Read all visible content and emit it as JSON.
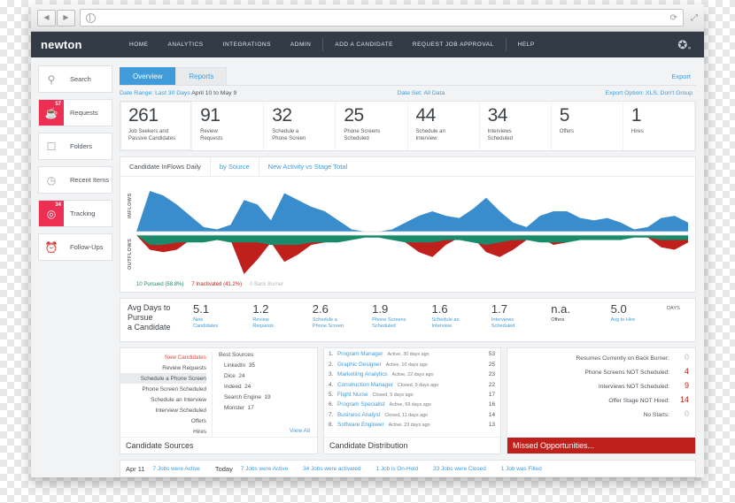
{
  "browser": {
    "url_value": "",
    "url_placeholder": "",
    "back_icon": "◀",
    "forward_icon": "▶",
    "reload_icon": "⟳",
    "expand_icon": "⤢"
  },
  "topnav": {
    "brand": "newton",
    "links": [
      "HOME",
      "ANALYTICS",
      "INTEGRATIONS",
      "ADMIN",
      "ADD A CANDIDATE",
      "REQUEST JOB APPROVAL",
      "HELP"
    ],
    "gear_icon": "✿"
  },
  "sidebar": {
    "items": [
      {
        "label": "Search",
        "icon": "search-icon",
        "glyph": "⌕",
        "badge": "",
        "active": false
      },
      {
        "label": "Requests",
        "icon": "bell-icon",
        "glyph": "🔔",
        "badge": "57",
        "active": true
      },
      {
        "label": "Folders",
        "icon": "folder-icon",
        "glyph": "🗀",
        "badge": "",
        "active": false
      },
      {
        "label": "Recent Items",
        "icon": "clock-icon",
        "glyph": "🕐",
        "badge": "",
        "active": false
      },
      {
        "label": "Tracking",
        "icon": "target-icon",
        "glyph": "◎",
        "badge": "34",
        "active": true
      },
      {
        "label": "Follow-Ups",
        "icon": "alarm-clock-icon",
        "glyph": "⏰",
        "badge": "",
        "active": false
      }
    ]
  },
  "tabs": {
    "items": [
      "Overview",
      "Reports"
    ],
    "active": "Overview",
    "export_label": "Export"
  },
  "meta": {
    "date_range_label": "Date Range:",
    "date_range_value": "Last 30 Days",
    "date_range_detail": "April 10 to May 9",
    "date_set": "Date Set: All Data",
    "export_option": "Export Option: XLS, Don't Group"
  },
  "stats": [
    {
      "num": "261",
      "label": "Job Seekers and\nPassive Candidates"
    },
    {
      "num": "91",
      "label": "Review\nRequests"
    },
    {
      "num": "32",
      "label": "Schedule a\nPhone Screen"
    },
    {
      "num": "25",
      "label": "Phone Screens\nScheduled"
    },
    {
      "num": "44",
      "label": "Schedule an\nInterview"
    },
    {
      "num": "34",
      "label": "Interviews\nScheduled"
    },
    {
      "num": "5",
      "label": "Offers"
    },
    {
      "num": "1",
      "label": "Hires"
    }
  ],
  "chart_tabs": {
    "items": [
      "Candidate InFlows Daily",
      "by Source",
      "New Activity vs Stage Total"
    ],
    "active": "by Source"
  },
  "chart_data": {
    "type": "area",
    "title": "Candidate InFlows Daily",
    "axis_labels": [
      "INFLOWS",
      "OUTFLOWS"
    ],
    "legend": [
      {
        "text": "10 Pursued (58.8%)",
        "color": "#1a8a6a"
      },
      {
        "text": "7 Inactivated (41.2%)",
        "color": "#c0201c"
      },
      {
        "text": "0 Back Burner",
        "color": "#b4b8bc"
      }
    ],
    "colors": {
      "inflows": "#3a8dcc",
      "pursued": "#1a8a6a",
      "inactivated": "#c0201c"
    },
    "x": [
      0,
      1,
      2,
      3,
      4,
      5,
      6,
      7,
      8,
      9,
      10,
      11,
      12,
      13,
      14,
      15,
      16,
      17,
      18,
      19,
      20,
      21,
      22,
      23,
      24,
      25,
      26,
      27,
      28,
      29,
      30,
      31,
      32,
      33,
      34,
      35,
      36,
      37,
      38,
      39
    ],
    "series": [
      {
        "name": "INFLOWS",
        "values": [
          0,
          18,
          16,
          12,
          7,
          2,
          1,
          3,
          14,
          12,
          5,
          17,
          14,
          11,
          9,
          5,
          1,
          0,
          0,
          1,
          4,
          7,
          9,
          7,
          6,
          10,
          15,
          9,
          4,
          2,
          7,
          9,
          9,
          6,
          5,
          6,
          4,
          1,
          2,
          6,
          7,
          4
        ]
      },
      {
        "name": "Pursued",
        "values": [
          0,
          4,
          4,
          3,
          3,
          3,
          2,
          3,
          3,
          3,
          4,
          4,
          4,
          3,
          3,
          3,
          2,
          1,
          1,
          2,
          3,
          3,
          3,
          2,
          2,
          3,
          4,
          3,
          2,
          2,
          3,
          3,
          3,
          2,
          2,
          2,
          2,
          1,
          1,
          2,
          2,
          2
        ]
      },
      {
        "name": "Inactivated",
        "values": [
          0,
          6,
          7,
          6,
          2,
          1,
          1,
          2,
          16,
          10,
          3,
          11,
          8,
          4,
          3,
          2,
          1,
          0,
          0,
          1,
          3,
          7,
          9,
          4,
          1,
          1,
          7,
          9,
          6,
          2,
          1,
          4,
          3,
          1,
          1,
          1,
          1,
          0,
          1,
          5,
          6,
          3
        ]
      }
    ],
    "grid": false,
    "legend_position": "bottom-left"
  },
  "avg_days": {
    "title": "Avg Days to Pursue\na Candidate",
    "unit": "DAYS",
    "cells": [
      {
        "value": "5.1",
        "label": "New\nCandidates",
        "muted": false
      },
      {
        "value": "1.2",
        "label": "Review\nRequests",
        "muted": false
      },
      {
        "value": "2.6",
        "label": "Schedule a\nPhone Screen",
        "muted": false
      },
      {
        "value": "1.9",
        "label": "Phone Screens\nScheduled",
        "muted": false
      },
      {
        "value": "1.6",
        "label": "Schedule an\nInterview",
        "muted": false
      },
      {
        "value": "1.7",
        "label": "Interviews\nScheduled",
        "muted": false
      },
      {
        "value": "n.a.",
        "label": "Offers",
        "muted": true
      },
      {
        "value": "5.0",
        "label": "Avg to Hire",
        "muted": false
      }
    ]
  },
  "candidate_sources": {
    "title": "Candidate Sources",
    "stages": [
      {
        "label": "New Candidates",
        "style": "red"
      },
      {
        "label": "Review Requests",
        "style": ""
      },
      {
        "label": "Schedule a Phone Screen",
        "style": "hl"
      },
      {
        "label": "Phone Screen Scheduled",
        "style": ""
      },
      {
        "label": "Schedule an Interview",
        "style": ""
      },
      {
        "label": "Interview Scheduled",
        "style": ""
      },
      {
        "label": "Offers",
        "style": ""
      },
      {
        "label": "Hires",
        "style": ""
      }
    ],
    "best_sources_header": "Best Sources",
    "best_sources": [
      {
        "name": "LinkedIn",
        "count": "35"
      },
      {
        "name": "Dice",
        "count": "24"
      },
      {
        "name": "Indeed",
        "count": "24"
      },
      {
        "name": "Search Engine",
        "count": "19"
      },
      {
        "name": "Monster",
        "count": "17"
      }
    ],
    "view_all": "View All"
  },
  "candidate_distribution": {
    "title": "Candidate Distribution",
    "jobs": [
      {
        "idx": "1.",
        "name": "Program Manager",
        "status": "Active, 30 days ago",
        "count": "53"
      },
      {
        "idx": "2.",
        "name": "Graphic Designer",
        "status": "Active, 10 days ago",
        "count": "25"
      },
      {
        "idx": "3.",
        "name": "Marketiing Analytics",
        "status": "Active, 22 days ago",
        "count": "23"
      },
      {
        "idx": "4.",
        "name": "Construction Manager",
        "status": "Closed, 9 days ago",
        "count": "22"
      },
      {
        "idx": "5.",
        "name": "Flight Nurse",
        "status": "Closed, 9 days ago",
        "count": "17"
      },
      {
        "idx": "6.",
        "name": "Program Specialist",
        "status": "Active, 69 days ago",
        "count": "16"
      },
      {
        "idx": "7.",
        "name": "Business Analyst",
        "status": "Closed, 11 days ago",
        "count": "14"
      },
      {
        "idx": "8.",
        "name": "Software Engineer",
        "status": "Active, 23 days ago",
        "count": "13"
      }
    ]
  },
  "missed_opportunities": {
    "title": "Missed Opportunities...",
    "rows": [
      {
        "label": "Resumes Currently on Back Burner:",
        "value": "0",
        "state": "zero"
      },
      {
        "label": "Phone Screens NOT Scheduled:",
        "value": "4",
        "state": "alert"
      },
      {
        "label": "Interviews NOT Scheduled:",
        "value": "9",
        "state": "alert"
      },
      {
        "label": "Offer Stage NOT Hired:",
        "value": "14",
        "state": "alert"
      },
      {
        "label": "No Starts:",
        "value": "0",
        "state": "zero"
      }
    ]
  },
  "footer": {
    "date": "Apr 11",
    "today": "Today",
    "left_stat": "7 Jobs were Active",
    "stats": [
      "7 Jobs were Active",
      "34 Jobs were activated",
      "1 Job is On-Hold",
      "33 Jobs were Closed",
      "1 Job was Filled"
    ]
  }
}
